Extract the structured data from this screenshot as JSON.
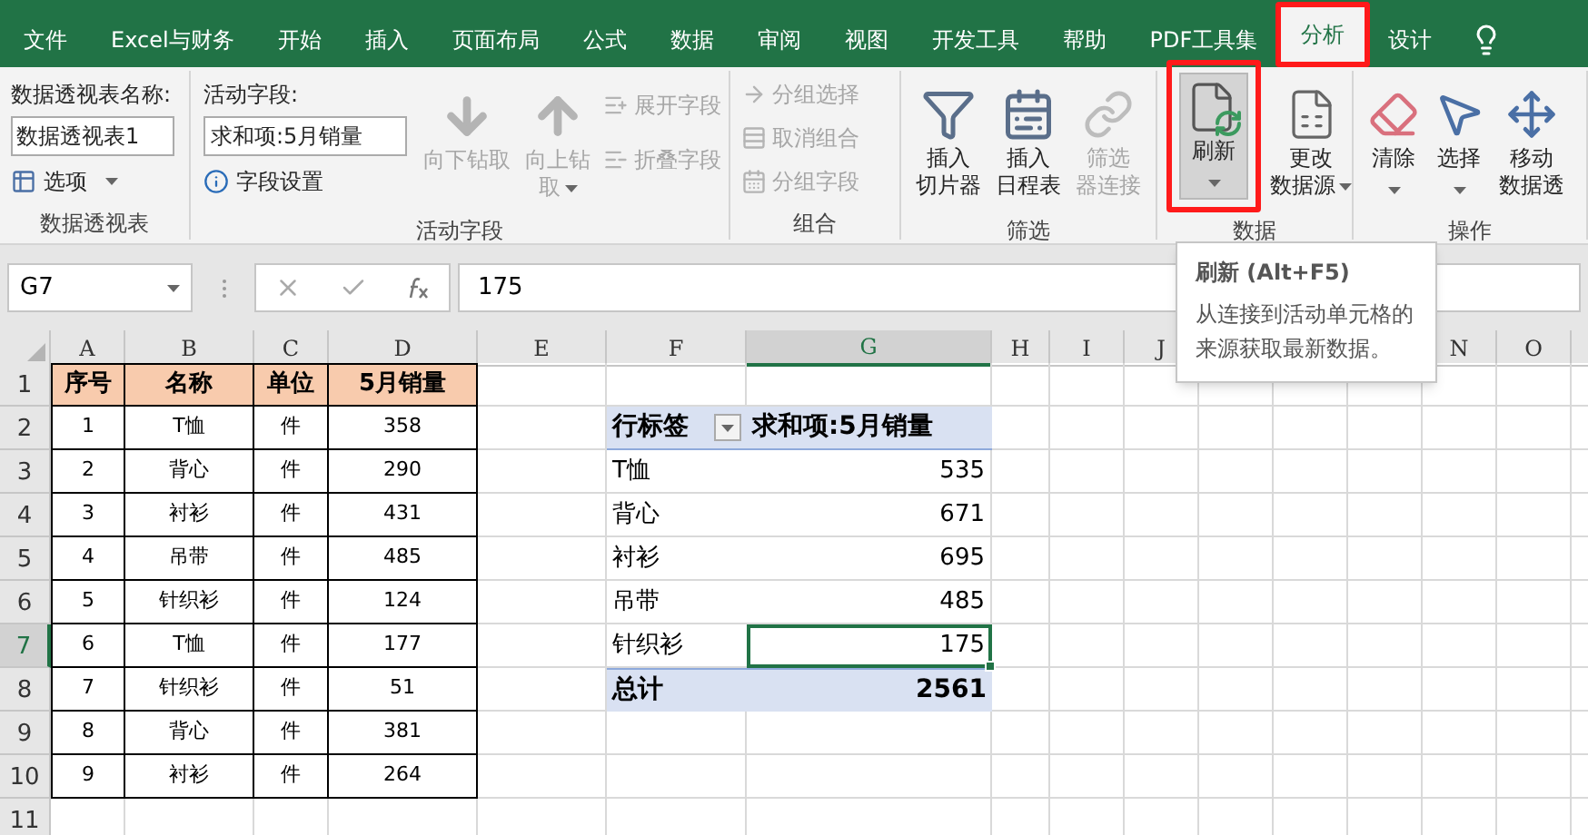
{
  "tabs": [
    {
      "label": "文件",
      "selected": false,
      "highlighted": false
    },
    {
      "label": "Excel与财务",
      "selected": false,
      "highlighted": false
    },
    {
      "label": "开始",
      "selected": false,
      "highlighted": false
    },
    {
      "label": "插入",
      "selected": false,
      "highlighted": false
    },
    {
      "label": "页面布局",
      "selected": false,
      "highlighted": false
    },
    {
      "label": "公式",
      "selected": false,
      "highlighted": false
    },
    {
      "label": "数据",
      "selected": false,
      "highlighted": false
    },
    {
      "label": "审阅",
      "selected": false,
      "highlighted": false
    },
    {
      "label": "视图",
      "selected": false,
      "highlighted": false
    },
    {
      "label": "开发工具",
      "selected": false,
      "highlighted": false
    },
    {
      "label": "帮助",
      "selected": false,
      "highlighted": false
    },
    {
      "label": "PDF工具集",
      "selected": false,
      "highlighted": false
    },
    {
      "label": "分析",
      "selected": true,
      "highlighted": true
    },
    {
      "label": "设计",
      "selected": false,
      "highlighted": false
    }
  ],
  "ribbon": {
    "groups": [
      {
        "kind": "pivot",
        "label": "数据透视表",
        "name_label": "数据透视表名称:",
        "name_value": "数据透视表1",
        "options": {
          "label": "选项",
          "dropdown": true
        }
      },
      {
        "kind": "field",
        "label": "活动字段",
        "field_label": "活动字段:",
        "field_value": "求和项:5月销量",
        "settings": "字段设置",
        "big": [
          {
            "lines": [
              "向下钻取"
            ],
            "disabled": true,
            "pressed": false,
            "highlighted": false,
            "dropdown": false
          },
          {
            "lines": [
              "向上钻",
              "取"
            ],
            "disabled": true,
            "pressed": false,
            "highlighted": false,
            "dropdown": true
          }
        ],
        "small": [
          {
            "label": "展开字段",
            "disabled": true
          },
          {
            "label": "折叠字段",
            "disabled": true
          }
        ]
      },
      {
        "kind": "group",
        "label": "组合",
        "small": [
          {
            "label": "分组选择",
            "disabled": true
          },
          {
            "label": "取消组合",
            "disabled": true
          },
          {
            "label": "分组字段",
            "disabled": true
          }
        ]
      },
      {
        "kind": "filter",
        "label": "筛选",
        "big": [
          {
            "lines": [
              "插入",
              "切片器"
            ],
            "disabled": false,
            "pressed": false,
            "highlighted": false,
            "dropdown": false
          },
          {
            "lines": [
              "插入",
              "日程表"
            ],
            "disabled": false,
            "pressed": false,
            "highlighted": false,
            "dropdown": false
          },
          {
            "lines": [
              "筛选",
              "器连接"
            ],
            "disabled": true,
            "pressed": false,
            "highlighted": false,
            "dropdown": false
          }
        ]
      },
      {
        "kind": "data",
        "label": "数据",
        "big": [
          {
            "lines": [
              "刷新"
            ],
            "disabled": false,
            "pressed": true,
            "highlighted": true,
            "dropdown": true
          },
          {
            "lines": [
              "更改",
              "数据源"
            ],
            "disabled": false,
            "pressed": false,
            "highlighted": false,
            "dropdown": true
          }
        ]
      },
      {
        "kind": "actions",
        "label": "操作",
        "big": [
          {
            "lines": [
              "清除"
            ],
            "disabled": false,
            "pressed": false,
            "highlighted": false,
            "dropdown": true
          },
          {
            "lines": [
              "选择"
            ],
            "disabled": false,
            "pressed": false,
            "highlighted": false,
            "dropdown": true
          },
          {
            "lines": [
              "移动",
              "数据透"
            ],
            "disabled": false,
            "pressed": false,
            "highlighted": false,
            "dropdown": false
          }
        ]
      }
    ]
  },
  "formula_bar": {
    "name_box": "G7",
    "value": "175"
  },
  "tooltip": {
    "title": "刷新 (Alt+F5)",
    "body": "从连接到活动单元格的来源获取最新数据。"
  },
  "sheet": {
    "columns": [
      {
        "label": "A",
        "selected": false
      },
      {
        "label": "B",
        "selected": false
      },
      {
        "label": "C",
        "selected": false
      },
      {
        "label": "D",
        "selected": false
      },
      {
        "label": "E",
        "selected": false
      },
      {
        "label": "F",
        "selected": false
      },
      {
        "label": "G",
        "selected": true
      },
      {
        "label": "H",
        "selected": false
      },
      {
        "label": "I",
        "selected": false
      },
      {
        "label": "J",
        "selected": false
      },
      {
        "label": "N",
        "selected": false
      },
      {
        "label": "O",
        "selected": false
      }
    ],
    "rows": [
      {
        "label": "1",
        "selected": false
      },
      {
        "label": "2",
        "selected": false
      },
      {
        "label": "3",
        "selected": false
      },
      {
        "label": "4",
        "selected": false
      },
      {
        "label": "5",
        "selected": false
      },
      {
        "label": "6",
        "selected": false
      },
      {
        "label": "7",
        "selected": true
      },
      {
        "label": "8",
        "selected": false
      },
      {
        "label": "9",
        "selected": false
      },
      {
        "label": "10",
        "selected": false
      },
      {
        "label": "11",
        "selected": false
      }
    ],
    "source_table": {
      "headers": [
        "序号",
        "名称",
        "单位",
        "5月销量"
      ],
      "rows": [
        [
          "1",
          "T恤",
          "件",
          "358"
        ],
        [
          "2",
          "背心",
          "件",
          "290"
        ],
        [
          "3",
          "衬衫",
          "件",
          "431"
        ],
        [
          "4",
          "吊带",
          "件",
          "485"
        ],
        [
          "5",
          "针织衫",
          "件",
          "124"
        ],
        [
          "6",
          "T恤",
          "件",
          "177"
        ],
        [
          "7",
          "针织衫",
          "件",
          "51"
        ],
        [
          "8",
          "背心",
          "件",
          "381"
        ],
        [
          "9",
          "衬衫",
          "件",
          "264"
        ]
      ]
    },
    "pivot": {
      "row_header": "行标签",
      "value_header": "求和项:5月销量",
      "rows": [
        {
          "label": "T恤",
          "value": "535",
          "selected": false
        },
        {
          "label": "背心",
          "value": "671",
          "selected": false
        },
        {
          "label": "衬衫",
          "value": "695",
          "selected": false
        },
        {
          "label": "吊带",
          "value": "485",
          "selected": false
        },
        {
          "label": "针织衫",
          "value": "175",
          "selected": true
        }
      ],
      "total": {
        "label": "总计",
        "value": "2561"
      }
    }
  }
}
